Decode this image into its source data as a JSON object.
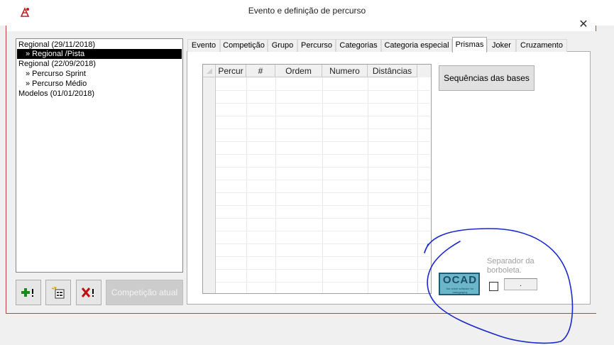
{
  "window": {
    "title": "Evento e definição de percurso",
    "close_glyph": "✕"
  },
  "tree": {
    "items": [
      {
        "label": "Regional (29/11/2018)",
        "level": 0,
        "selected": false
      },
      {
        "label": "» Regional /Pista",
        "level": 1,
        "selected": true
      },
      {
        "label": "Regional (22/09/2018)",
        "level": 0,
        "selected": false
      },
      {
        "label": "» Percurso Sprint",
        "level": 1,
        "selected": false
      },
      {
        "label": "» Percurso Médio",
        "level": 1,
        "selected": false
      },
      {
        "label": "Modelos (01/01/2018)",
        "level": 0,
        "selected": false
      }
    ]
  },
  "buttons": {
    "current_competition": "Competição atual"
  },
  "tabs": [
    {
      "label": "Evento",
      "active": false
    },
    {
      "label": "Competição",
      "active": false
    },
    {
      "label": "Grupo",
      "active": false
    },
    {
      "label": "Percurso",
      "active": false
    },
    {
      "label": "Categorias",
      "active": false
    },
    {
      "label": "Categoria especial",
      "active": false
    },
    {
      "label": "Prismas",
      "active": true
    },
    {
      "label": "Joker",
      "active": false
    },
    {
      "label": "Cruzamento",
      "active": false
    }
  ],
  "grid": {
    "columns": [
      "Percur",
      "#",
      "Ordem",
      "Numero",
      "Distâncias"
    ]
  },
  "sequence_button": "Sequências das bases",
  "ocad": {
    "logo_text": "OCAD",
    "logo_sub": "the orient software for cartography"
  },
  "separator": {
    "label": "Separador da borboleta.",
    "value": "."
  },
  "colors": {
    "window_border": "#c04040",
    "annotation": "#1a28d0"
  }
}
